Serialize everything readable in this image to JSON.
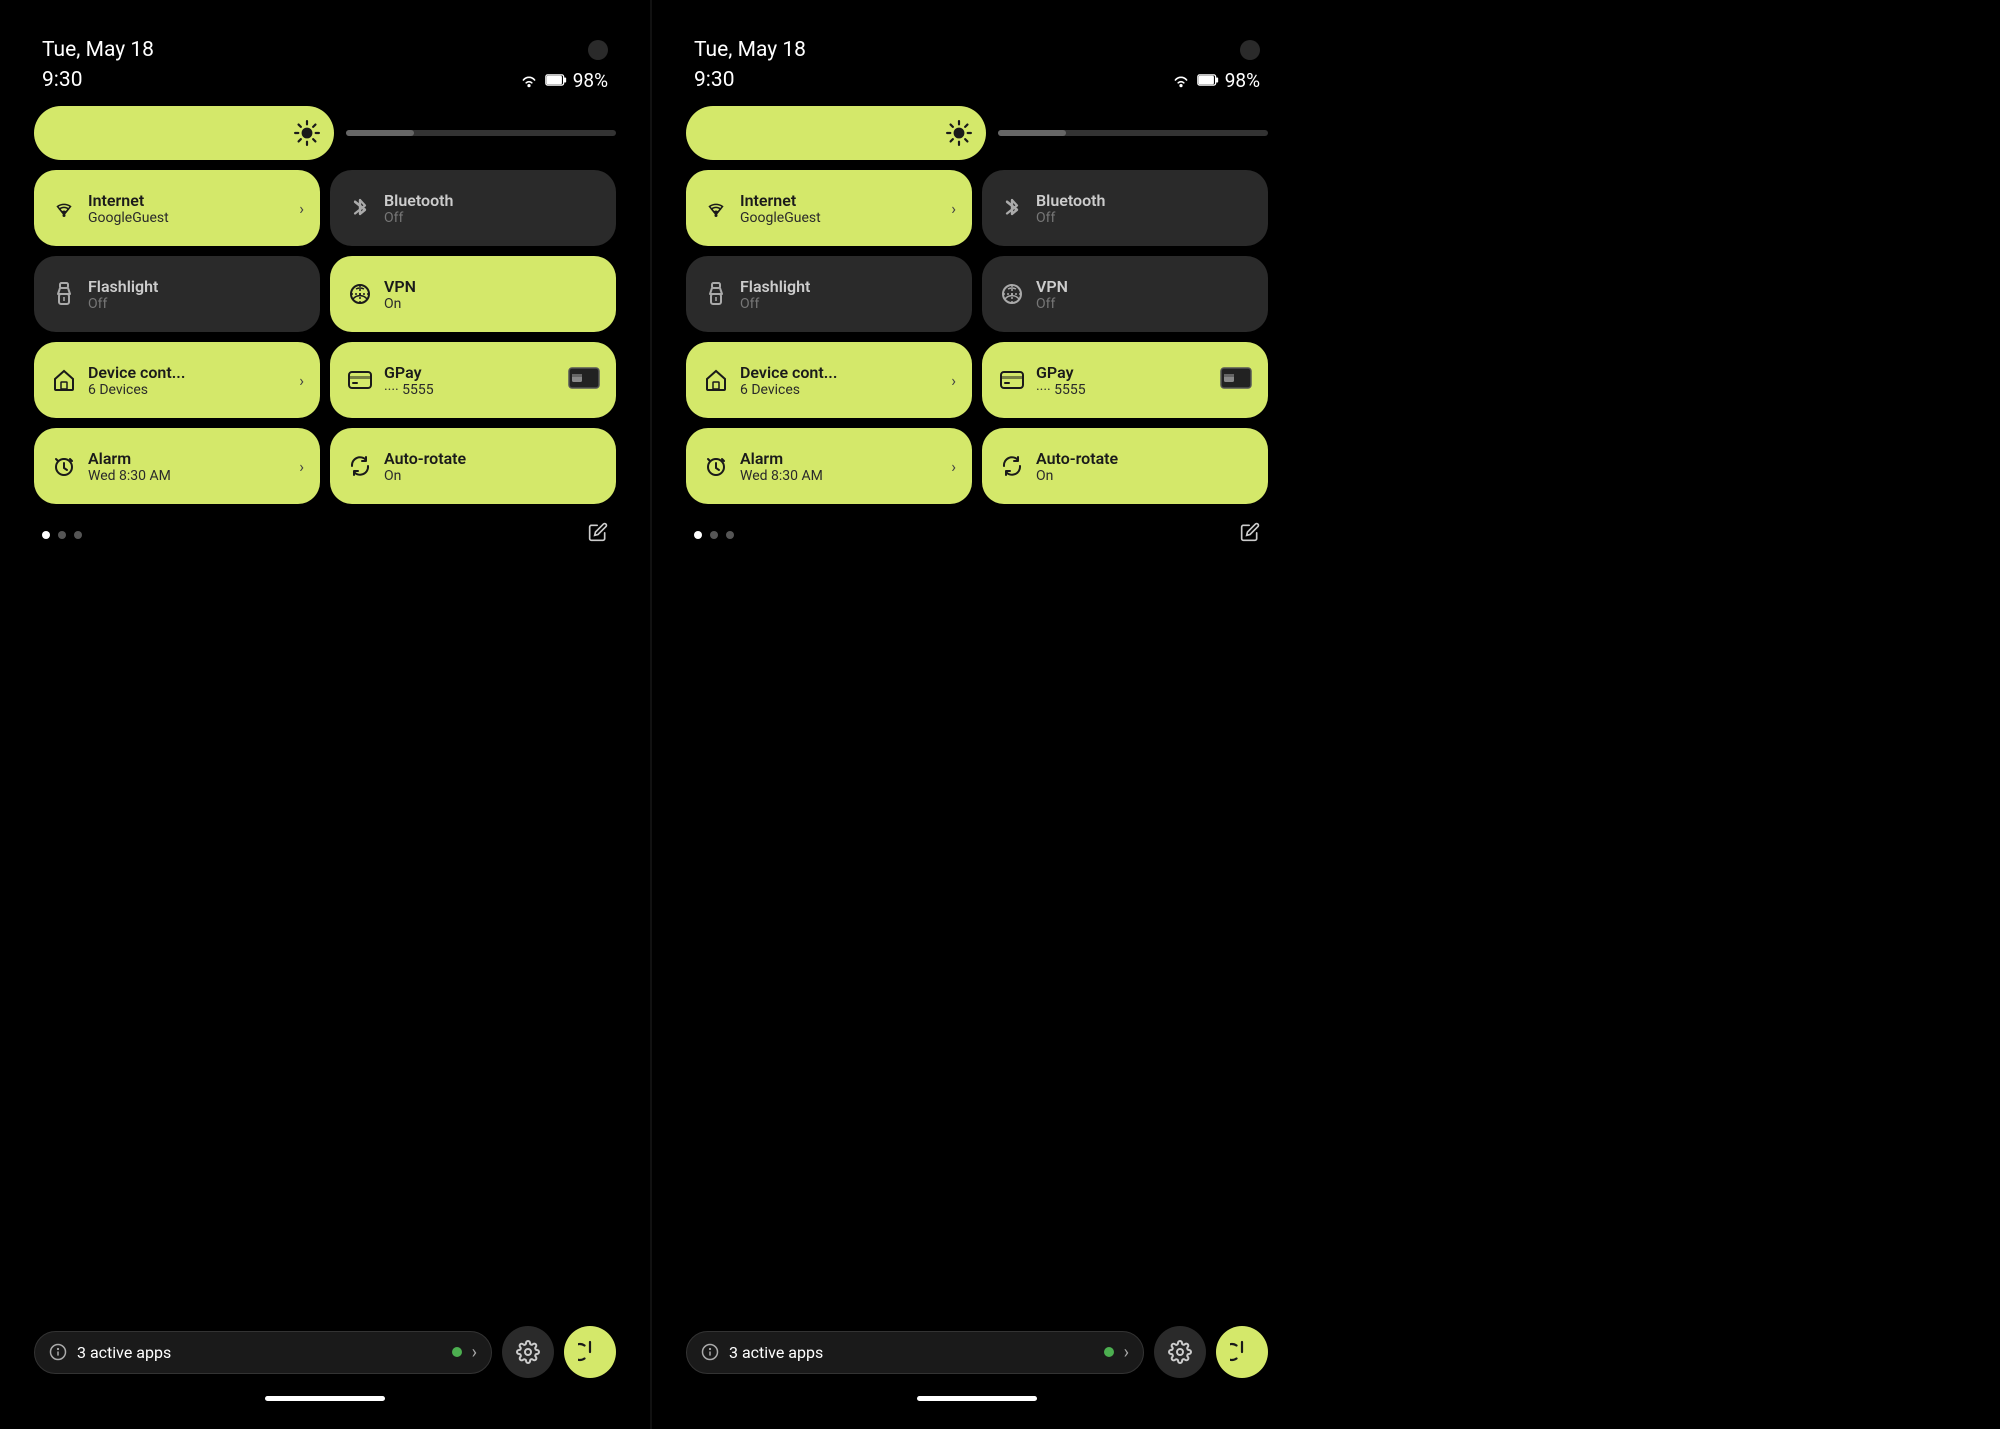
{
  "panels": [
    {
      "id": "left",
      "date": "Tue, May 18",
      "time": "9:30",
      "battery": "98%",
      "brightness": 50,
      "tiles": [
        {
          "id": "internet",
          "title": "Internet",
          "subtitle": "GoogleGuest",
          "state": "active",
          "icon": "wifi",
          "hasChevron": true
        },
        {
          "id": "bluetooth",
          "title": "Bluetooth",
          "subtitle": "Off",
          "state": "inactive",
          "icon": "bluetooth",
          "hasChevron": false
        },
        {
          "id": "flashlight",
          "title": "Flashlight",
          "subtitle": "Off",
          "state": "inactive",
          "icon": "flashlight",
          "hasChevron": false
        },
        {
          "id": "vpn",
          "title": "VPN",
          "subtitle": "On",
          "state": "active",
          "icon": "vpn",
          "hasChevron": false
        },
        {
          "id": "device",
          "title": "Device cont...",
          "subtitle": "6 Devices",
          "state": "active",
          "icon": "home",
          "hasChevron": true
        },
        {
          "id": "gpay",
          "title": "GPay",
          "subtitle": "···· 5555",
          "state": "active",
          "icon": "card",
          "hasChevron": false,
          "hasCardIcon": true
        },
        {
          "id": "alarm",
          "title": "Alarm",
          "subtitle": "Wed 8:30 AM",
          "state": "active",
          "icon": "alarm",
          "hasChevron": true
        },
        {
          "id": "autorotate",
          "title": "Auto-rotate",
          "subtitle": "On",
          "state": "active",
          "icon": "rotate",
          "hasChevron": false
        }
      ],
      "dots": [
        true,
        false,
        false
      ],
      "activeApps": "3 active apps",
      "settingsLabel": "⚙",
      "powerLabel": "⏻"
    },
    {
      "id": "right",
      "date": "Tue, May 18",
      "time": "9:30",
      "battery": "98%",
      "brightness": 50,
      "tiles": [
        {
          "id": "internet",
          "title": "Internet",
          "subtitle": "GoogleGuest",
          "state": "active",
          "icon": "wifi",
          "hasChevron": true
        },
        {
          "id": "bluetooth",
          "title": "Bluetooth",
          "subtitle": "Off",
          "state": "inactive",
          "icon": "bluetooth",
          "hasChevron": false
        },
        {
          "id": "flashlight",
          "title": "Flashlight",
          "subtitle": "Off",
          "state": "inactive",
          "icon": "flashlight",
          "hasChevron": false
        },
        {
          "id": "vpn",
          "title": "VPN",
          "subtitle": "Off",
          "state": "inactive",
          "icon": "vpn",
          "hasChevron": false
        },
        {
          "id": "device",
          "title": "Device cont...",
          "subtitle": "6 Devices",
          "state": "active",
          "icon": "home",
          "hasChevron": true
        },
        {
          "id": "gpay",
          "title": "GPay",
          "subtitle": "···· 5555",
          "state": "active",
          "icon": "card",
          "hasChevron": false,
          "hasCardIcon": true
        },
        {
          "id": "alarm",
          "title": "Alarm",
          "subtitle": "Wed 8:30 AM",
          "state": "active",
          "icon": "alarm",
          "hasChevron": true
        },
        {
          "id": "autorotate",
          "title": "Auto-rotate",
          "subtitle": "On",
          "state": "active",
          "icon": "rotate",
          "hasChevron": false
        }
      ],
      "dots": [
        true,
        false,
        false
      ],
      "activeApps": "3 active apps",
      "settingsLabel": "⚙",
      "powerLabel": "⏻"
    }
  ]
}
